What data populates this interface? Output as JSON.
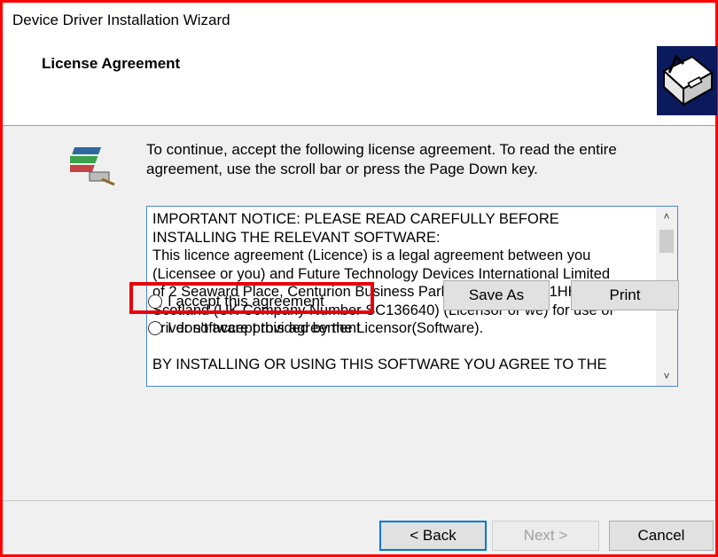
{
  "window": {
    "title": "Device Driver Installation Wizard"
  },
  "header": {
    "title": "License Agreement",
    "icon": "wizard-install-icon"
  },
  "instructions": {
    "icon": "package-installer-icon",
    "text": "To continue, accept the following license agreement. To read the entire agreement, use the scroll bar or press the Page Down key."
  },
  "license": {
    "text": "IMPORTANT NOTICE: PLEASE READ CAREFULLY BEFORE\nINSTALLING THE RELEVANT SOFTWARE:\nThis licence agreement (Licence) is a legal agreement between you\n(Licensee or you) and Future Technology Devices International Limited\nof 2 Seaward Place, Centurion Business Park, Glasgow G41 1HH,\nScotland (UK Company Number SC136640) (Licensor or we) for use of\ndriver software provided by the Licensor(Software).\n\nBY INSTALLING OR USING THIS SOFTWARE YOU AGREE TO THE",
    "scroll_up_icon": "chevron-up-icon",
    "scroll_down_icon": "chevron-down-icon"
  },
  "options": {
    "accept_label": "I accept this agreement",
    "decline_label": "I don't accept this agreement"
  },
  "actions": {
    "save_as_label": "Save As",
    "print_label": "Print"
  },
  "footer": {
    "back_label": "< Back",
    "next_label": "Next >",
    "cancel_label": "Cancel"
  },
  "colors": {
    "highlight": "#e8000b",
    "frame": "#ff0000",
    "focus_border": "#0078d7"
  }
}
